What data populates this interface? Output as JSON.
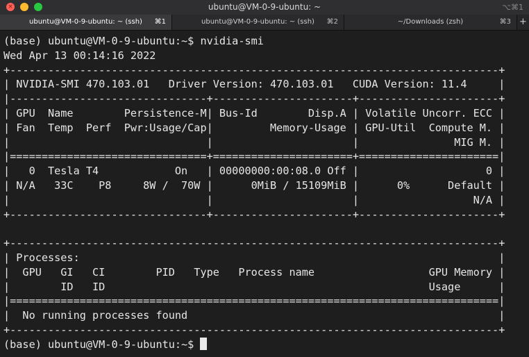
{
  "window": {
    "title": "ubuntu@VM-0-9-ubuntu: ~",
    "shortcut_hint": "⌥⌘1"
  },
  "tabs": [
    {
      "label": "ubuntu@VM-0-9-ubuntu: ~ (ssh)",
      "key": "⌘1",
      "active": true
    },
    {
      "label": "ubuntu@VM-0-9-ubuntu: ~ (ssh)",
      "key": "⌘2",
      "active": false
    },
    {
      "label": "~/Downloads (zsh)",
      "key": "⌘3",
      "active": false
    }
  ],
  "tab_add_label": "+",
  "terminal": {
    "lines": [
      "(base) ubuntu@VM-0-9-ubuntu:~$ nvidia-smi",
      "Wed Apr 13 00:14:16 2022",
      "+-----------------------------------------------------------------------------+",
      "| NVIDIA-SMI 470.103.01   Driver Version: 470.103.01   CUDA Version: 11.4     |",
      "|-------------------------------+----------------------+----------------------+",
      "| GPU  Name        Persistence-M| Bus-Id        Disp.A | Volatile Uncorr. ECC |",
      "| Fan  Temp  Perf  Pwr:Usage/Cap|         Memory-Usage | GPU-Util  Compute M. |",
      "|                               |                      |               MIG M. |",
      "|===============================+======================+======================|",
      "|   0  Tesla T4            On   | 00000000:00:08.0 Off |                    0 |",
      "| N/A   33C    P8     8W /  70W |      0MiB / 15109MiB |      0%      Default |",
      "|                               |                      |                  N/A |",
      "+-------------------------------+----------------------+----------------------+",
      "",
      "+-----------------------------------------------------------------------------+",
      "| Processes:                                                                  |",
      "|  GPU   GI   CI        PID   Type   Process name                  GPU Memory |",
      "|        ID   ID                                                   Usage      |",
      "|=============================================================================|",
      "|  No running processes found                                                 |",
      "+-----------------------------------------------------------------------------+"
    ],
    "prompt": "(base) ubuntu@VM-0-9-ubuntu:~$ "
  }
}
